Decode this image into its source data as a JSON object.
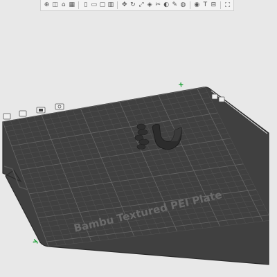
{
  "toolbar": {
    "icons": [
      "add-icon",
      "add-plate-icon",
      "orient-icon",
      "arrange-icon",
      "split-icon",
      "move-icon",
      "rotate-icon",
      "scale-icon",
      "lay-on-face-icon",
      "cut-icon",
      "mesh-boolean-icon",
      "support-paint-icon",
      "seam-paint-icon",
      "color-paint-icon",
      "text-icon",
      "measure-icon",
      "assembly-icon"
    ]
  },
  "plate": {
    "label": "Bambu Textured PEI Plate",
    "axis_x": "x",
    "axis_y": "y",
    "colors": {
      "plate": "#404040",
      "grid": "#5a5a5a",
      "edge": "#2a2a2a",
      "background": "#e8e8e8"
    }
  },
  "plate_tools": [
    "arrange-icon",
    "orient-icon",
    "lock-icon",
    "settings-icon"
  ]
}
